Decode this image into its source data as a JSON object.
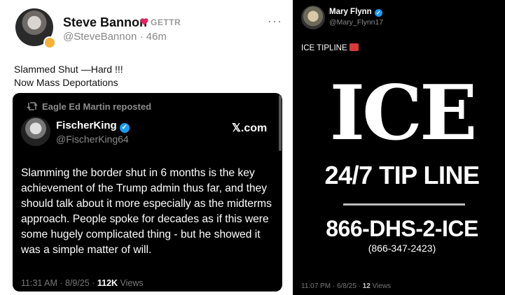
{
  "left_post": {
    "author_name": "Steve Bannon",
    "platform_label": "GETTR",
    "author_handle": "@SteveBannon · 46m",
    "more_dots": "···",
    "text_line1": "Slammed Shut —Hard !!!",
    "text_line2": "Now Mass Deportations",
    "colors": {
      "heart": "#e0245e",
      "badge": "#f3b23a"
    },
    "repost": {
      "repost_label": "Eagle Ed Martin reposted",
      "name": "FischerKing",
      "handle": "@FischerKing64",
      "source": "𝕏.com",
      "body": "Slamming the border shut in 6 months is the key achievement of the Trump admin thus far, and they should talk about it more especially as the midterms approach. People spoke for decades as if this were some hugely complicated thing - but he showed it was a simple matter of will.",
      "timestamp": "11:31 AM · 8/9/25 · ",
      "views_count": "112K",
      "views_label": " Views"
    }
  },
  "right_post": {
    "name": "Mary Flynn",
    "handle": "@Mary_Flynn17",
    "text": "ICE TIPLINE",
    "image": {
      "title": "ICE",
      "subtitle": "24/7 TIP LINE",
      "phone": "866-DHS-2-ICE",
      "phone_numeric": "(866-347-2423)"
    },
    "timestamp": "11:07 PM · 6/8/25 · ",
    "views_count": "12",
    "views_label": " Views"
  },
  "icons": {
    "verified": "verified-check-icon",
    "repost": "repost-icon",
    "siren": "siren-icon",
    "heart": "gettr-heart-icon"
  },
  "colors": {
    "verified_blue": "#1d9bf0",
    "muted": "#8b8b8b"
  }
}
